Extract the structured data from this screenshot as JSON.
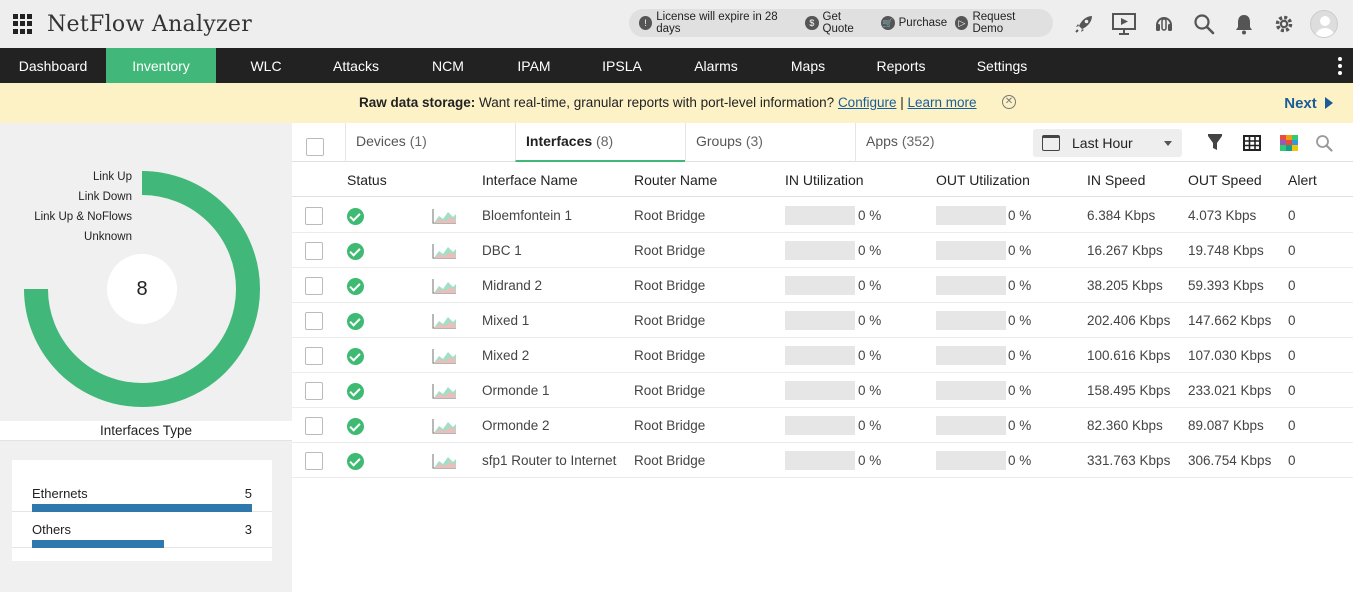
{
  "app": {
    "title": "NetFlow Analyzer"
  },
  "promo": {
    "license": "License will expire in 28 days",
    "quote": "Get Quote",
    "purchase": "Purchase",
    "demo": "Request Demo"
  },
  "top_icons": [
    "rocket-icon",
    "presentation-icon",
    "support-headset-icon",
    "search-icon",
    "bell-icon",
    "gear-icon",
    "user-avatar-icon"
  ],
  "nav": {
    "items": [
      {
        "label": "Dashboard",
        "w": 0
      },
      {
        "label": "Inventory",
        "active": true
      },
      {
        "label": "WLC"
      },
      {
        "label": "Attacks"
      },
      {
        "label": "NCM"
      },
      {
        "label": "IPAM"
      },
      {
        "label": "IPSLA"
      },
      {
        "label": "Alarms"
      },
      {
        "label": "Maps"
      },
      {
        "label": "Reports"
      },
      {
        "label": "Settings"
      }
    ]
  },
  "banner": {
    "bold": "Raw data storage:",
    "text": " Want real-time, granular reports with port-level information? ",
    "configure": "Configure",
    "sep": " | ",
    "learn": "Learn more",
    "next": "Next"
  },
  "donut": {
    "legend": [
      "Link Up",
      "Link Down",
      "Link Up & NoFlows",
      "Unknown"
    ],
    "total": "8",
    "color": "#41b879"
  },
  "interfaces_type": {
    "title": "Interfaces Type",
    "rows": [
      {
        "label": "Ethernets",
        "count": "5",
        "fraction": 1.0
      },
      {
        "label": "Others",
        "count": "3",
        "fraction": 0.6
      }
    ]
  },
  "tabs": [
    {
      "label": "Devices",
      "count": "(1)"
    },
    {
      "label": "Interfaces",
      "count": "(8)",
      "active": true
    },
    {
      "label": "Groups",
      "count": "(3)"
    },
    {
      "label": "Apps",
      "count": "(352)"
    }
  ],
  "time_range": "Last Hour",
  "table": {
    "headers": [
      "Status",
      "Interface Name",
      "Router Name",
      "IN Utilization",
      "OUT Utilization",
      "IN Speed",
      "OUT Speed",
      "Alert"
    ],
    "rows": [
      {
        "name": "Bloemfontein 1",
        "router": "Root Bridge",
        "in_util": "0 %",
        "out_util": "0 %",
        "in_speed": "6.384 Kbps",
        "out_speed": "4.073 Kbps",
        "alert": "0"
      },
      {
        "name": "DBC 1",
        "router": "Root Bridge",
        "in_util": "0 %",
        "out_util": "0 %",
        "in_speed": "16.267 Kbps",
        "out_speed": "19.748 Kbps",
        "alert": "0"
      },
      {
        "name": "Midrand 2",
        "router": "Root Bridge",
        "in_util": "0 %",
        "out_util": "0 %",
        "in_speed": "38.205 Kbps",
        "out_speed": "59.393 Kbps",
        "alert": "0"
      },
      {
        "name": "Mixed 1",
        "router": "Root Bridge",
        "in_util": "0 %",
        "out_util": "0 %",
        "in_speed": "202.406 Kbps",
        "out_speed": "147.662 Kbps",
        "alert": "0"
      },
      {
        "name": "Mixed 2",
        "router": "Root Bridge",
        "in_util": "0 %",
        "out_util": "0 %",
        "in_speed": "100.616 Kbps",
        "out_speed": "107.030 Kbps",
        "alert": "0"
      },
      {
        "name": "Ormonde 1",
        "router": "Root Bridge",
        "in_util": "0 %",
        "out_util": "0 %",
        "in_speed": "158.495 Kbps",
        "out_speed": "233.021 Kbps",
        "alert": "0"
      },
      {
        "name": "Ormonde 2",
        "router": "Root Bridge",
        "in_util": "0 %",
        "out_util": "0 %",
        "in_speed": "82.360 Kbps",
        "out_speed": "89.087 Kbps",
        "alert": "0"
      },
      {
        "name": "sfp1 Router to Internet",
        "router": "Root Bridge",
        "in_util": "0 %",
        "out_util": "0 %",
        "in_speed": "331.763 Kbps",
        "out_speed": "306.754 Kbps",
        "alert": "0"
      }
    ]
  },
  "colors": {
    "accent": "#41b879",
    "nav_bg": "#222222",
    "banner_bg": "#fdf2c6",
    "link": "#1a5c96",
    "bar": "#2e78ad"
  }
}
